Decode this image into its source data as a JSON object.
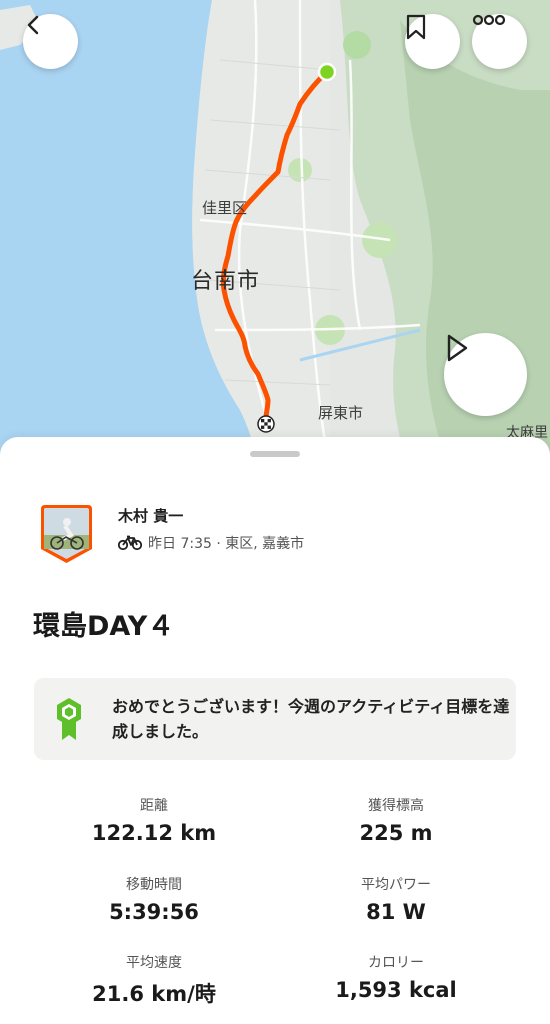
{
  "map": {
    "labels": {
      "jiali": "佳里区",
      "tainan": "台南市",
      "pingtung": "屏東市",
      "taimali": "太麻里"
    },
    "route_color": "#fc5200",
    "start_color": "#7ed321"
  },
  "athlete": {
    "name": "木村 貴一",
    "meta": "昨日 7:35 · 東区, 嘉義市"
  },
  "activity": {
    "title": "環島DAY４"
  },
  "goal": {
    "message": "おめでとうございます！今週のアクティビティ目標を達成しました。"
  },
  "stats": [
    {
      "label": "距離",
      "value": "122.12 km"
    },
    {
      "label": "獲得標高",
      "value": "225 m"
    },
    {
      "label": "移動時間",
      "value": "5:39:56"
    },
    {
      "label": "平均パワー",
      "value": "81 W"
    },
    {
      "label": "平均速度",
      "value": "21.6 km/時"
    },
    {
      "label": "カロリー",
      "value": "1,593 kcal"
    }
  ],
  "icons": {
    "back": "chevron-left-icon",
    "save": "bookmark-icon",
    "more": "more-icon",
    "play": "play-icon",
    "bike": "bike-icon",
    "goal": "achievement-badge-icon"
  },
  "colors": {
    "accent": "#fc5200",
    "goal_green": "#5fbf2a"
  }
}
